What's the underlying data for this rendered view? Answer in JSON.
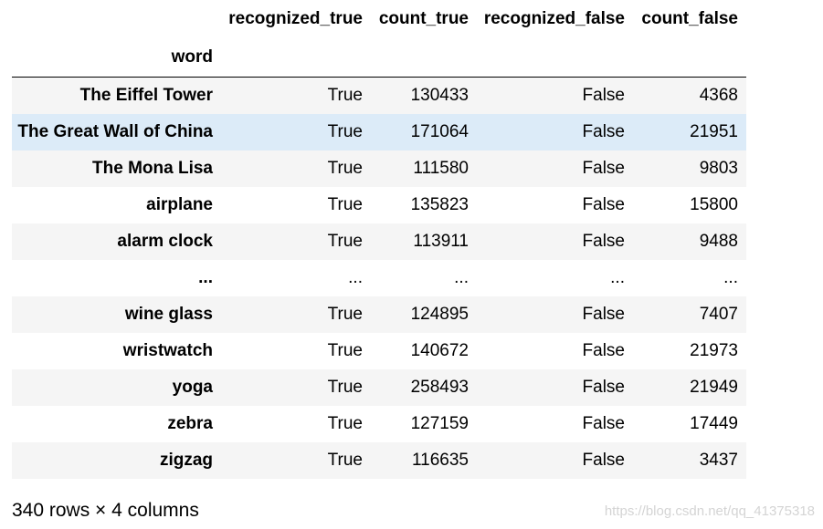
{
  "table": {
    "columns": [
      "recognized_true",
      "count_true",
      "recognized_false",
      "count_false"
    ],
    "index_name": "word",
    "rows": [
      {
        "word": "The Eiffel Tower",
        "recognized_true": "True",
        "count_true": "130433",
        "recognized_false": "False",
        "count_false": "4368"
      },
      {
        "word": "The Great Wall of China",
        "recognized_true": "True",
        "count_true": "171064",
        "recognized_false": "False",
        "count_false": "21951"
      },
      {
        "word": "The Mona Lisa",
        "recognized_true": "True",
        "count_true": "111580",
        "recognized_false": "False",
        "count_false": "9803"
      },
      {
        "word": "airplane",
        "recognized_true": "True",
        "count_true": "135823",
        "recognized_false": "False",
        "count_false": "15800"
      },
      {
        "word": "alarm clock",
        "recognized_true": "True",
        "count_true": "113911",
        "recognized_false": "False",
        "count_false": "9488"
      },
      {
        "word": "...",
        "recognized_true": "...",
        "count_true": "...",
        "recognized_false": "...",
        "count_false": "..."
      },
      {
        "word": "wine glass",
        "recognized_true": "True",
        "count_true": "124895",
        "recognized_false": "False",
        "count_false": "7407"
      },
      {
        "word": "wristwatch",
        "recognized_true": "True",
        "count_true": "140672",
        "recognized_false": "False",
        "count_false": "21973"
      },
      {
        "word": "yoga",
        "recognized_true": "True",
        "count_true": "258493",
        "recognized_false": "False",
        "count_false": "21949"
      },
      {
        "word": "zebra",
        "recognized_true": "True",
        "count_true": "127159",
        "recognized_false": "False",
        "count_false": "17449"
      },
      {
        "word": "zigzag",
        "recognized_true": "True",
        "count_true": "116635",
        "recognized_false": "False",
        "count_false": "3437"
      }
    ],
    "hovered_row": 1,
    "shape_caption": "340 rows × 4 columns"
  },
  "watermark": "https://blog.csdn.net/qq_41375318",
  "colors": {
    "row_shade": "#f5f5f5",
    "row_hover": "#dcebf8",
    "header_rule": "#000000",
    "watermark": "#d4d4d4"
  }
}
